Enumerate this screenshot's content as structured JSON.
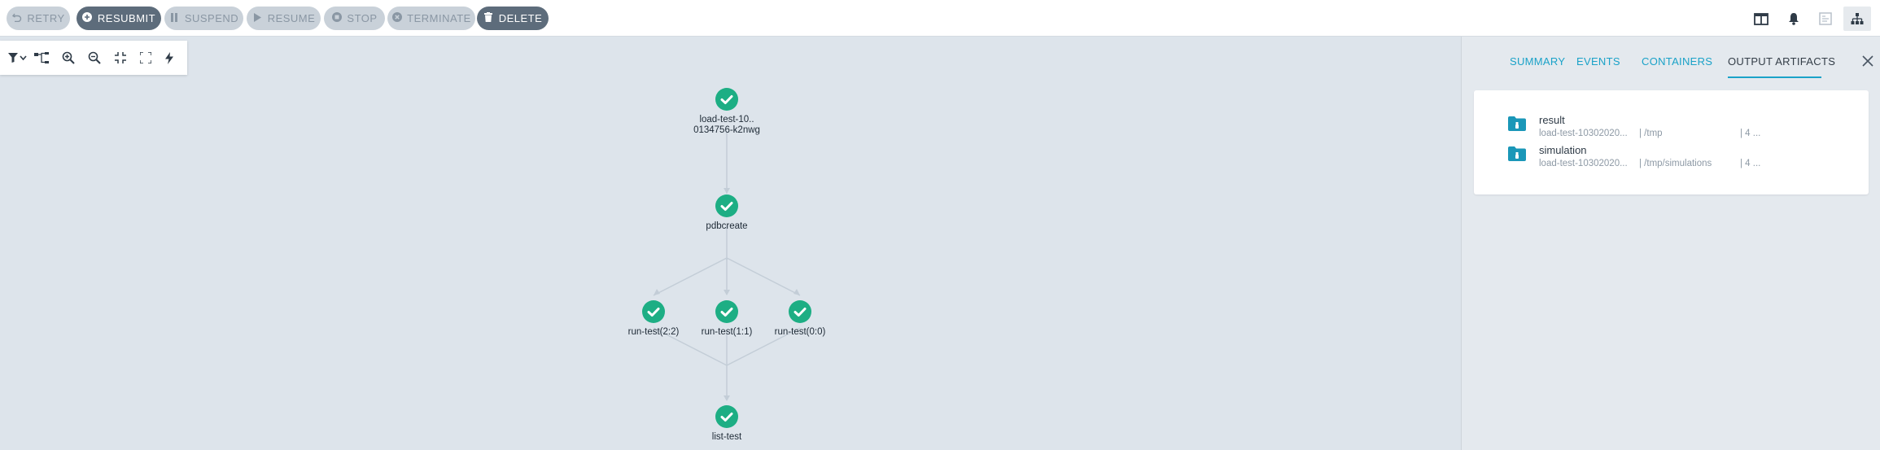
{
  "toolbar": {
    "retry": "RETRY",
    "resubmit": "RESUBMIT",
    "suspend": "SUSPEND",
    "resume": "RESUME",
    "stop": "STOP",
    "terminate": "TERMINATE",
    "delete": "DELETE"
  },
  "graph": {
    "nodes": {
      "root_line1": "load-test-10..",
      "root_line2": "0134756-k2nwg",
      "pdbcreate": "pdbcreate",
      "run2": "run-test(2:2)",
      "run1": "run-test(1:1)",
      "run0": "run-test(0:0)",
      "list": "list-test"
    }
  },
  "panel": {
    "tabs": [
      "SUMMARY",
      "EVENTS",
      "CONTAINERS",
      "OUTPUT ARTIFACTS"
    ],
    "active_tab": "OUTPUT ARTIFACTS",
    "artifacts": [
      {
        "name": "result",
        "key": "load-test-10302020...",
        "path": "| /tmp",
        "size": "| 4 ..."
      },
      {
        "name": "simulation",
        "key": "load-test-10302020...",
        "path": "| /tmp/simulations",
        "size": "| 4 ..."
      }
    ]
  },
  "colors": {
    "success": "#1dae84",
    "accent": "#1aa2c8",
    "button_dark": "#5d6c7b",
    "button_disabled": "#c9d1d9"
  }
}
